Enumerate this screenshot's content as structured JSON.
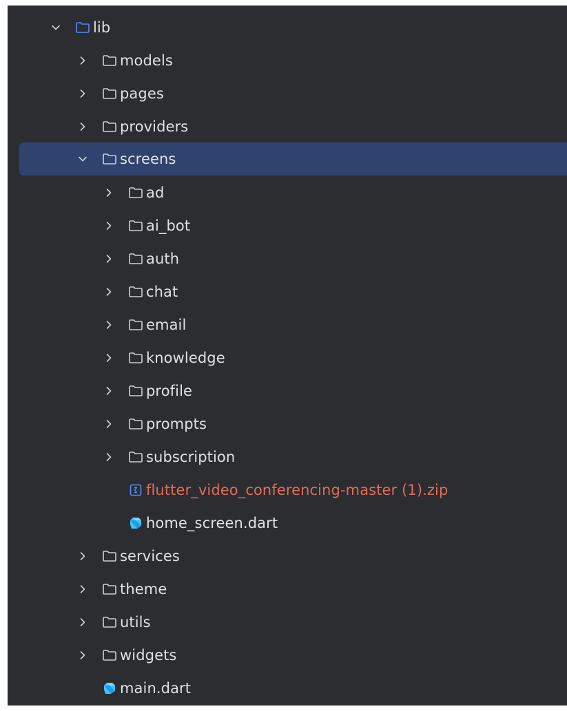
{
  "colors": {
    "panel_bg": "#2b2d30",
    "selection_bg": "#2e436e",
    "text": "#dfe1e5",
    "error_text": "#e06c5c",
    "folder_stroke": "#ced0d6",
    "module_folder_stroke": "#548af7",
    "dart_icon": "#40c4ff"
  },
  "tree": {
    "lib": {
      "label": "lib",
      "expanded": true,
      "icon": "module-folder-icon"
    },
    "models": {
      "label": "models",
      "expanded": false,
      "icon": "folder-icon"
    },
    "pages": {
      "label": "pages",
      "expanded": false,
      "icon": "folder-icon"
    },
    "providers": {
      "label": "providers",
      "expanded": false,
      "icon": "folder-icon"
    },
    "screens": {
      "label": "screens",
      "expanded": true,
      "selected": true,
      "icon": "folder-icon"
    },
    "ad": {
      "label": "ad",
      "expanded": false,
      "icon": "folder-icon"
    },
    "ai_bot": {
      "label": "ai_bot",
      "expanded": false,
      "icon": "folder-icon"
    },
    "auth": {
      "label": "auth",
      "expanded": false,
      "icon": "folder-icon"
    },
    "chat": {
      "label": "chat",
      "expanded": false,
      "icon": "folder-icon"
    },
    "email": {
      "label": "email",
      "expanded": false,
      "icon": "folder-icon"
    },
    "knowledge": {
      "label": "knowledge",
      "expanded": false,
      "icon": "folder-icon"
    },
    "profile": {
      "label": "profile",
      "expanded": false,
      "icon": "folder-icon"
    },
    "prompts": {
      "label": "prompts",
      "expanded": false,
      "icon": "folder-icon"
    },
    "subscription": {
      "label": "subscription",
      "expanded": false,
      "icon": "folder-icon"
    },
    "zip_file": {
      "label": "flutter_video_conferencing-master (1).zip",
      "icon": "archive-icon",
      "status": "error"
    },
    "home_screen": {
      "label": "home_screen.dart",
      "icon": "dart-file-icon"
    },
    "services": {
      "label": "services",
      "expanded": false,
      "icon": "folder-icon"
    },
    "theme": {
      "label": "theme",
      "expanded": false,
      "icon": "folder-icon"
    },
    "utils": {
      "label": "utils",
      "expanded": false,
      "icon": "folder-icon"
    },
    "widgets": {
      "label": "widgets",
      "expanded": false,
      "icon": "folder-icon"
    },
    "main_dart": {
      "label": "main.dart",
      "icon": "dart-file-icon"
    }
  }
}
